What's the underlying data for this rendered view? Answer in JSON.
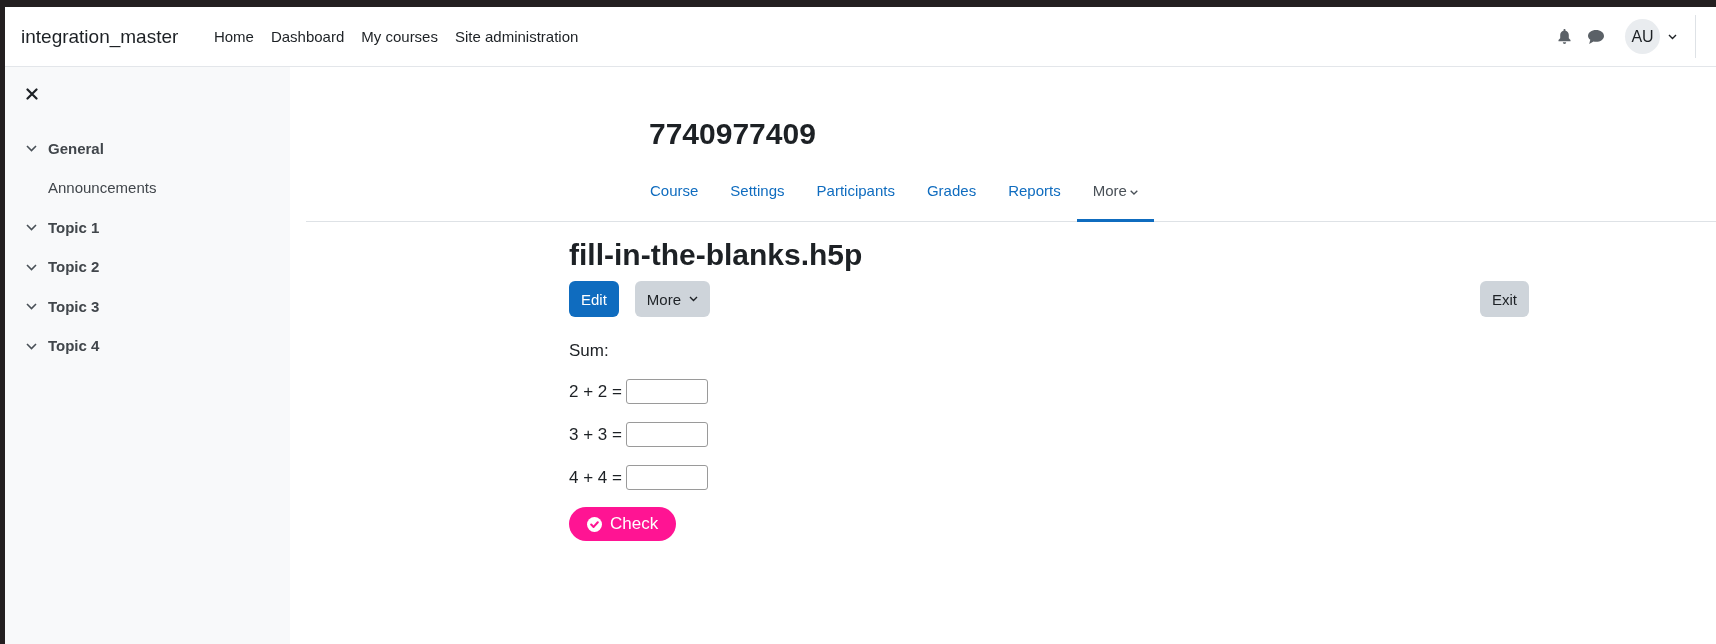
{
  "header": {
    "brand": "integration_master",
    "nav": [
      {
        "label": "Home",
        "selected": false
      },
      {
        "label": "Dashboard",
        "selected": false
      },
      {
        "label": "My courses",
        "selected": false
      },
      {
        "label": "Site administration",
        "selected": false
      }
    ],
    "avatar": "AU"
  },
  "course_index": {
    "items": [
      {
        "label": "General",
        "expanded": true,
        "children": [
          {
            "label": "Announcements"
          }
        ]
      },
      {
        "label": "Topic 1",
        "expanded": true
      },
      {
        "label": "Topic 2",
        "expanded": true
      },
      {
        "label": "Topic 3",
        "expanded": true
      },
      {
        "label": "Topic 4",
        "expanded": true
      }
    ]
  },
  "course": {
    "title": "7740977409",
    "tabs": [
      {
        "label": "Course",
        "kind": "link",
        "selected": false
      },
      {
        "label": "Settings",
        "kind": "link",
        "selected": false
      },
      {
        "label": "Participants",
        "kind": "link",
        "selected": false
      },
      {
        "label": "Grades",
        "kind": "link",
        "selected": false
      },
      {
        "label": "Reports",
        "kind": "link",
        "selected": false
      },
      {
        "label": "More",
        "kind": "dropdown",
        "selected": true
      }
    ]
  },
  "activity": {
    "title": "fill-in-the-blanks.h5p",
    "buttons": [
      {
        "label": "Edit",
        "kind": "primary"
      },
      {
        "label": "More",
        "kind": "secondary",
        "dropdown": true
      }
    ],
    "exit_button": {
      "label": "Exit",
      "kind": "secondary"
    },
    "h5p": {
      "prompt": "Sum:",
      "blanks": [
        {
          "label": "2 + 2 ="
        },
        {
          "label": "3 + 3 ="
        },
        {
          "label": "4 + 4 ="
        }
      ],
      "check_button": "Check"
    }
  }
}
